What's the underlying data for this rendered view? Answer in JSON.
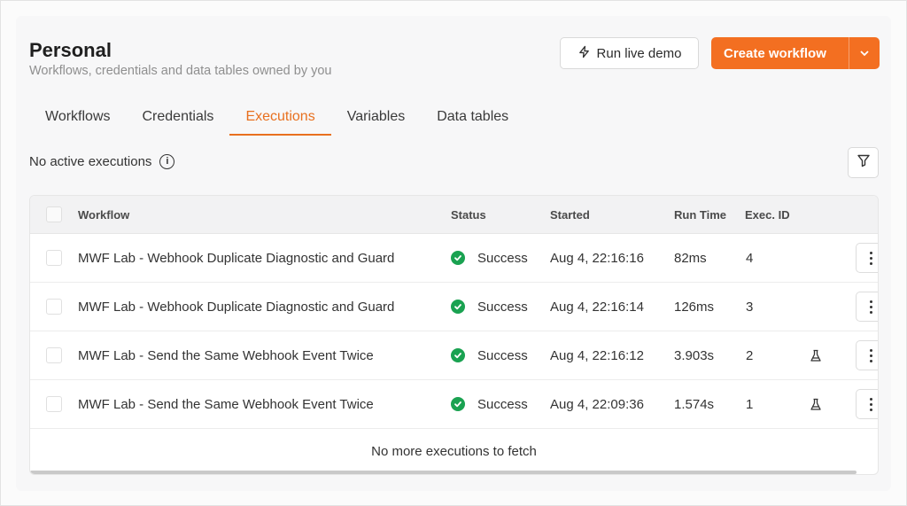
{
  "page": {
    "title": "Personal",
    "subtitle": "Workflows, credentials and data tables owned by you"
  },
  "actions": {
    "demo_label": "Run live demo",
    "create_label": "Create workflow"
  },
  "tabs": [
    {
      "label": "Workflows",
      "active": false
    },
    {
      "label": "Credentials",
      "active": false
    },
    {
      "label": "Executions",
      "active": true
    },
    {
      "label": "Variables",
      "active": false
    },
    {
      "label": "Data tables",
      "active": false
    }
  ],
  "status_line": "No active executions",
  "table": {
    "columns": {
      "workflow": "Workflow",
      "status": "Status",
      "started": "Started",
      "runtime": "Run Time",
      "exec_id": "Exec. ID"
    },
    "rows": [
      {
        "workflow": "MWF Lab - Webhook Duplicate Diagnostic and Guard",
        "status": "Success",
        "started": "Aug 4, 22:16:16",
        "runtime": "82ms",
        "exec_id": "4",
        "test_icon": false
      },
      {
        "workflow": "MWF Lab - Webhook Duplicate Diagnostic and Guard",
        "status": "Success",
        "started": "Aug 4, 22:16:14",
        "runtime": "126ms",
        "exec_id": "3",
        "test_icon": false
      },
      {
        "workflow": "MWF Lab - Send the Same Webhook Event Twice",
        "status": "Success",
        "started": "Aug 4, 22:16:12",
        "runtime": "3.903s",
        "exec_id": "2",
        "test_icon": true
      },
      {
        "workflow": "MWF Lab - Send the Same Webhook Event Twice",
        "status": "Success",
        "started": "Aug 4, 22:09:36",
        "runtime": "1.574s",
        "exec_id": "1",
        "test_icon": true
      }
    ],
    "footer": "No more executions to fetch"
  },
  "colors": {
    "accent": "#f36f21",
    "tab_active": "#e8701f",
    "success": "#1aa251"
  },
  "icons": {
    "demo": "lightning-icon",
    "create_dropdown": "chevron-down-icon",
    "info": "info-icon",
    "filter": "filter-icon",
    "success": "check-circle-icon",
    "test": "flask-icon",
    "menu": "more-vertical-icon"
  }
}
